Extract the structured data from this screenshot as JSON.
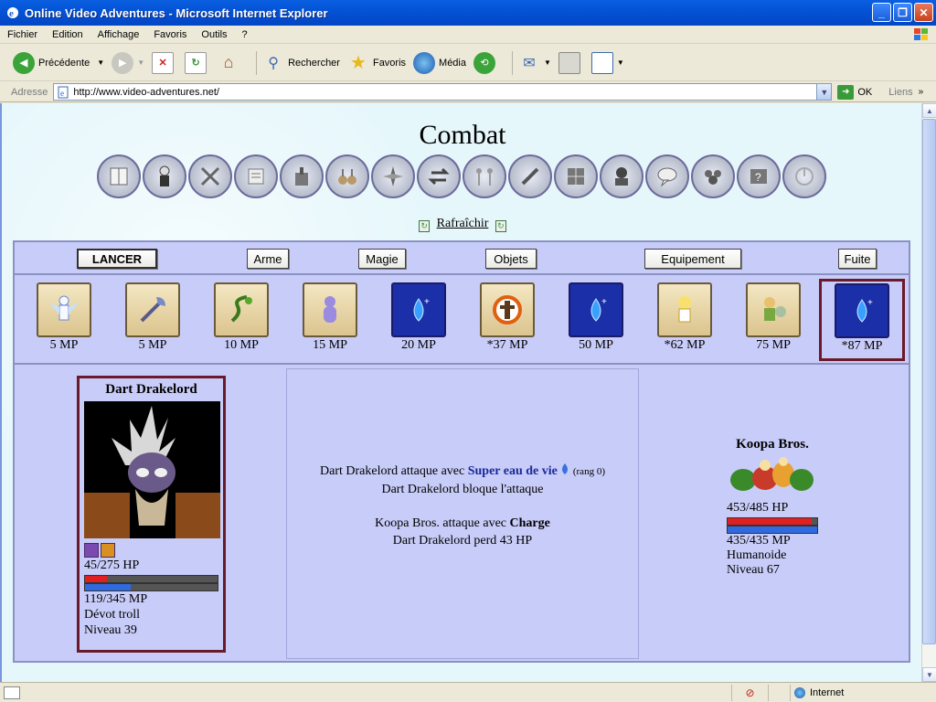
{
  "window": {
    "title": "Online Video Adventures - Microsoft Internet Explorer"
  },
  "menu": [
    "Fichier",
    "Edition",
    "Affichage",
    "Favoris",
    "Outils",
    "?"
  ],
  "toolbar": {
    "back": "Précédente",
    "search": "Rechercher",
    "favorites": "Favoris",
    "media": "Média"
  },
  "address": {
    "label": "Adresse",
    "url": "http://www.video-adventures.net/",
    "go": "OK",
    "links": "Liens"
  },
  "page": {
    "title": "Combat",
    "refresh": "Rafraîchir"
  },
  "actions": [
    "LANCER",
    "Arme",
    "Magie",
    "Objets",
    "Equipement",
    "Fuite"
  ],
  "spells": [
    {
      "cost": "5 MP",
      "icon": "angel-icon"
    },
    {
      "cost": "5 MP",
      "icon": "axe-icon"
    },
    {
      "cost": "10 MP",
      "icon": "vine-icon"
    },
    {
      "cost": "15 MP",
      "icon": "spirit-icon"
    },
    {
      "cost": "20 MP",
      "icon": "water-drop-icon"
    },
    {
      "cost": "*37 MP",
      "icon": "target-icon"
    },
    {
      "cost": "50 MP",
      "icon": "water-drop-icon"
    },
    {
      "cost": "*62 MP",
      "icon": "fairy-icon"
    },
    {
      "cost": "75 MP",
      "icon": "knight-icon"
    },
    {
      "cost": "*87 MP",
      "icon": "water-drop-icon"
    }
  ],
  "player": {
    "name": "Dart Drakelord",
    "hp": "45/275 HP",
    "hp_fraction": 0.164,
    "mp": "119/345 MP",
    "mp_fraction": 0.345,
    "race": "Dévot troll",
    "level": "Niveau 39"
  },
  "log": {
    "line1_pre": "Dart Drakelord attaque avec",
    "line1_spell": "Super eau de vie",
    "line1_post": "(rang 0)",
    "line2": "Dart Drakelord bloque l'attaque",
    "line3_pre": "Koopa Bros. attaque avec",
    "line3_attack": "Charge",
    "line4": "Dart Drakelord perd 43 HP"
  },
  "enemy": {
    "name": "Koopa Bros.",
    "hp": "453/485 HP",
    "hp_fraction": 0.934,
    "mp": "435/435 MP",
    "mp_fraction": 1.0,
    "type": "Humanoide",
    "level": "Niveau 67"
  },
  "status": {
    "zone": "Internet"
  },
  "colors": {
    "hp": "#e02020",
    "mp": "#2f6ae0",
    "selected": "#6a1a2a"
  }
}
